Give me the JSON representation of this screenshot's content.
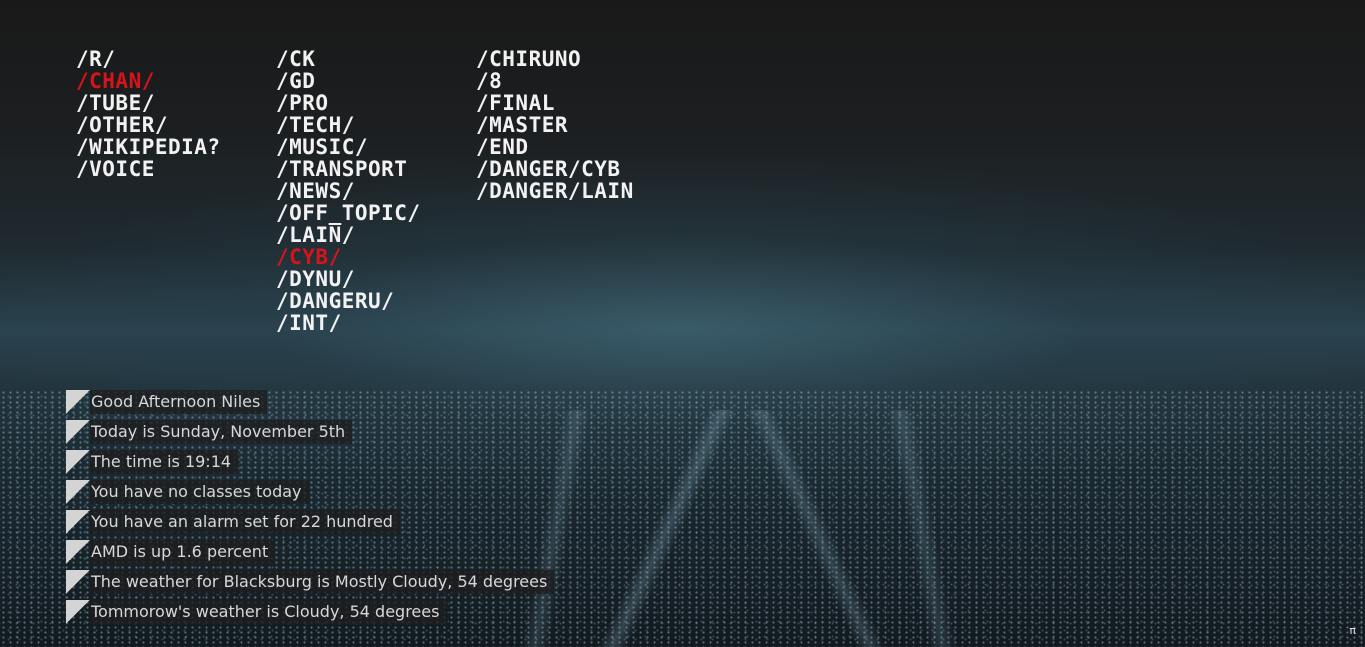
{
  "links": {
    "column1": [
      "/R/",
      "/CHAN/",
      "/TUBE/",
      "/OTHER/",
      "/WIKIPEDIA?",
      "/VOICE"
    ],
    "column2": [
      "/CK",
      "/GD",
      "/PRO",
      "/TECH/",
      "/MUSIC/",
      "/TRANSPORT",
      "/NEWS/",
      "/OFF_TOPIC/",
      "/LAIN/",
      "/CYB/",
      "/DYNU/",
      "/DANGERU/",
      "/INT/"
    ],
    "column3": [
      "/CHIRUNO",
      "/8",
      "/FINAL",
      "/MASTER",
      "/END",
      "/DANGER/CYB",
      "/DANGER/LAIN"
    ],
    "highlighted": [
      "/CHAN/",
      "/CYB/"
    ]
  },
  "messages": [
    "Good Afternoon Niles",
    "Today is Sunday, November 5th",
    "The time is 19:14",
    "You have no classes today",
    "You have an alarm set for 22 hundred",
    "AMD is up 1.6 percent",
    "The weather for Blacksburg is Mostly Cloudy, 54 degrees",
    "Tommorow's weather is Cloudy, 54 degrees"
  ],
  "corner_symbol": "π",
  "colors": {
    "link": "#f2f2f2",
    "link_highlight": "#d6141a",
    "message_text": "#d8d8d8"
  },
  "icons": {
    "message_marker": "triangle-marker-icon"
  }
}
